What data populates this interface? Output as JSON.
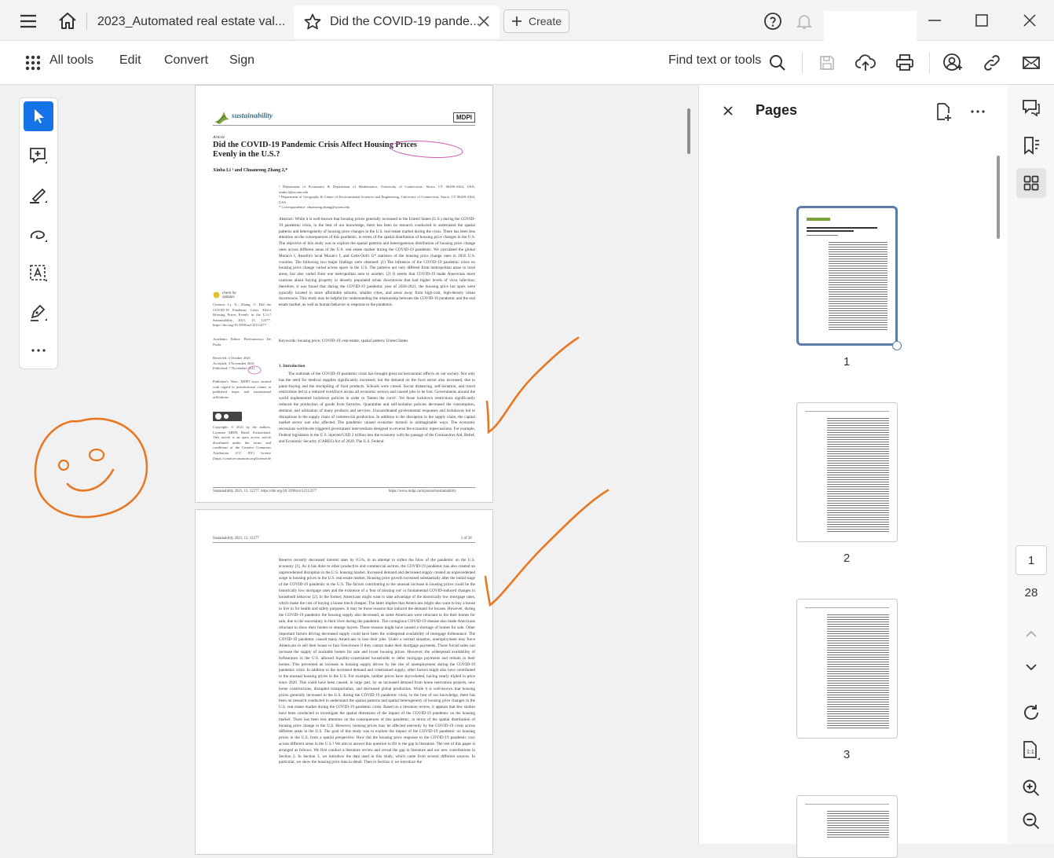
{
  "tabs": [
    {
      "label": "2023_Automated real estate val..."
    },
    {
      "label": "Did the COVID-19 pande..."
    }
  ],
  "create_label": "Create",
  "toolbar": {
    "all_tools": "All tools",
    "edit": "Edit",
    "convert": "Convert",
    "sign": "Sign",
    "find": "Find text or tools"
  },
  "pages_panel": {
    "title": "Pages",
    "thumbnails": [
      {
        "label": "1"
      },
      {
        "label": "2"
      },
      {
        "label": "3"
      }
    ]
  },
  "page_nav": {
    "current": "1",
    "total": "28"
  },
  "document": {
    "journal": "sustainability",
    "publisher": "MDPI",
    "article_type": "Article",
    "title_line1": "Did the COVID-19 Pandemic Crisis Affect Housing Prices",
    "title_line2": "Evenly in the U.S.?",
    "authors": "Xinba Li ¹ and Chuanrong Zhang 2,*",
    "affil1": "¹  Department of Economics & Department of Mathematics, University of Connecticut, Storrs, CT 06269-4164, USA; xinba.li@uconn.edu",
    "affil2": "²  Department of Geography & Center of Environmental Sciences and Engineering, University of Connecticut, Storrs, CT 06269-4164, USA",
    "affil3": "*  Correspondence: chuanrong.zhang@uconn.edu",
    "abstract": "Abstract: While it is well-known that housing prices generally increased in the United States (U.S.) during the COVID-19 pandemic crisis, to the best of our knowledge, there has been no research conducted to understand the spatial patterns and heterogeneity of housing price changes in the U.S. real estate market during the crisis. There has been less attention on the consequences of this pandemic, in terms of the spatial distribution of housing price changes in the U.S. The objective of this study was to explore the spatial patterns and heterogeneous distribution of housing price change rates across different areas of the U.S. real estate market during the COVID-19 pandemic. We calculated the global Moran's I, Anselin's local Moran's I, and Getis-Ord's G* statistics of the housing price change rates in 2856 U.S. counties. The following two major findings were obtained: (1) The influence of the COVID-19 pandemic crisis on housing price change varied across space in the U.S. The patterns not only differed from metropolitan areas to rural areas, but also varied from one metropolitan area to another. (2) It seems that COVID-19 made Americans more cautious about buying property in densely populated urban downtowns that had higher levels of virus infection; therefore, it was found that during the COVID-19 pandemic year of 2020-2021, the housing price hot spots were typically located in more affordable suburbs, smaller cities, and areas away from high-cost, high-density urban downtowns. This study may be helpful for understanding the relationship between the COVID-19 pandemic and the real estate market, as well as human behavior in response to the pandemic.",
    "keywords": "Keywords: housing price; COVID-19; real estate; spatial pattern; United States",
    "check_updates": "check for updates",
    "citation": "Citation: Li, X.; Zhang, C. Did the COVID-19 Pandemic Crisis Affect Housing Prices Evenly in the U.S.? Sustainability 2021, 13, 12277. https://doi.org/10.3390/su132112277",
    "editor": "Academic Editor: Pierfrancesco De Paola",
    "received": "Received: 4 October 2021",
    "accepted": "Accepted: 3 November 2021",
    "published": "Published: 7 November 2021",
    "publisher_note": "Publisher's Note: MDPI stays neutral with regard to jurisdictional claims in published maps and institutional affiliations.",
    "copyright": "Copyright: © 2021 by the authors. Licensee MDPI, Basel, Switzerland. This article is an open access article distributed under the terms and conditions of the Creative Commons Attribution (CC BY) license (https://creativecommons.org/licenses/by/4.0/).",
    "intro_heading": "1. Introduction",
    "intro_text": "The outbreak of the COVID-19 pandemic crisis has brought great socioeconomic effects on our society. Not only has the need for medical supplies significantly increased, but the demand on the food sector also increased, due to panic-buying and the stockpiling of food products. Schools were closed. Social distancing, self-isolation, and travel restrictions led to a reduced workforce across all economic sectors and caused jobs to be lost. Governments around the world implemented lockdown policies in order to 'flatten the curve'. Yet those lockdown restrictions significantly reduced the production of goods from factories. Quarantine and self-isolation policies decreased the consumption, demand, and utilization of many products and services. Uncoordinated governmental responses and lockdowns led to disruptions in the supply chain of commercial production. In addition to the disruption in the supply chain, the capital market sector was also affected. The pandemic caused economic turmoil in unimaginable ways. The economic recessions worldwide triggered government interventions designed to reverse the economic repercussions. For example, Federal legislators in the U.S. injected USD 2 trillion into the economy with the passage of the Coronavirus Aid, Relief, and Economic Security (CARES) Act of 2020. The U.S. Federal",
    "footer_left": "Sustainability 2021, 13, 12277. https://doi.org/10.3390/su132112277",
    "footer_right": "https://www.mdpi.com/journal/sustainability",
    "p2_header_left": "Sustainability 2021, 13, 12277",
    "p2_header_right": "2 of 28",
    "p2_text": "Reserve recently decreased interest rates by 0.5%, in an attempt to soften the blow of the pandemic on the U.S. economy [1]. As it has done to other productive and commercial sectors, the COVID-19 pandemic has also created an unprecedented disruption in the U.S. housing market. Increased demand and decreased supply created an unprecedented surge in housing prices in the U.S. real estate market. Housing price growth increased substantially after the initial stage of the COVID-19 pandemic in the U.S. The factors contributing to the unusual increase in housing prices could be the historically low mortgage rates and the existence of a 'fear of missing out' or fundamental COVID-induced changes in household behavior [2]. In the former, Americans might want to take advantage of the historically low mortgage rates, which make the cost of buying a house much cheaper. The latter implies that Americans might also want to buy a house to live in for health and safety purposes. It may be those reasons that induced the demand for houses. However, during the COVID-19 pandemic the housing supply also decreased, as some Americans were reluctant to list their homes for sale, due to the uncertainty in their lives during the pandemic. The contagious COVID-19 disease also made Americans reluctant to show their homes to strange buyers. Those reasons might have caused a shortage of homes for sale. Other important factors driving decreased supply could have been the widespread availability of mortgage forbearance. The COVID-19 pandemic caused many Americans to lose their jobs. Under a normal situation, unemployment may force Americans to sell their house or face foreclosure if they cannot make their mortgage payments. Those forced sales can increase the supply of available homes for sale and lower housing prices. However, the widespread availability of forbearance in the U.S. allowed liquidity-constrained households to defer mortgage payments and remain in their homes. This prevented an increase in housing supply driven by the rise of unemployment during the COVID-19 pandemic crisis. In addition to the increased demand and constrained supply, other factors might also have contributed to the unusual housing prices in the U.S. For example, lumber prices have skyrocketed, having nearly tripled in price since 2020. This could have been caused, in large part, by an increased demand from home renovation projects, new home constructions, disrupted transportation, and decreased global production. While it is well-known that housing prices generally increased in the U.S. during the COVID-19 pandemic crisis, to the best of our knowledge, there has been no research conducted to understand the spatial patterns and spatial heterogeneity of housing price changes in the U.S. real estate market during the COVID-19 pandemic crisis. Based on a literature review, it appears that few studies have been conducted to investigate the spatial dimension of the impact of the COVID-19 pandemic on the housing market. There has been less attention on the consequences of this pandemic, in terms of the spatial distribution of housing price change in the U.S. However, housing prices may be affected unevenly by the COVID-19 crisis across different areas in the U.S. The goal of this study was to explore the impact of the COVID-19 pandemic on housing prices in the U.S. from a spatial perspective. How did the housing price response to the COVID-19 pandemic vary across different areas in the U.S.? We aim to answer this question to fill in the gap in literature. The rest of this paper is arranged as follows. We first conduct a literature review and reveal the gap in literature and our new contributions in Section 2. In Section 3, we introduce the data used in this study, which came from several different sources. In particular, we show the housing price data in detail. Then in Section 4, we introduce the"
  },
  "colors": {
    "accent": "#1473e6",
    "annotation": "#e87722",
    "highlight_ring": "#d45bb7",
    "thumb_border": "#5b7ba8"
  },
  "icons": [
    "menu-icon",
    "home-icon",
    "star-icon",
    "close-icon",
    "plus-icon",
    "help-icon",
    "bell-icon",
    "minimize-icon",
    "maximize-icon",
    "window-close-icon",
    "grid-icon",
    "search-icon",
    "save-icon",
    "upload-icon",
    "print-icon",
    "share-user-icon",
    "link-icon",
    "mail-icon",
    "cursor-icon",
    "comment-icon",
    "highlight-icon",
    "draw-icon",
    "text-box-icon",
    "sign-pen-icon",
    "more-icon",
    "add-page-icon",
    "comment-panel-icon",
    "bookmark-icon",
    "pages-thumbnails-icon",
    "chevron-up-icon",
    "chevron-down-icon",
    "refresh-icon",
    "fit-page-icon",
    "zoom-in-icon",
    "zoom-out-icon"
  ]
}
